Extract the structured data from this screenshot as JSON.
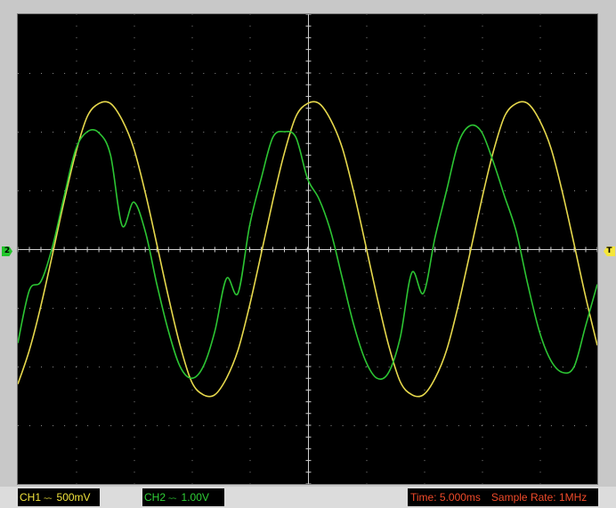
{
  "chart_data": {
    "type": "line",
    "title": "",
    "xlabel": "",
    "ylabel": "",
    "grid": true,
    "grid_divisions": {
      "x": 10,
      "y": 8
    },
    "xlim": [
      -25,
      25
    ],
    "x_unit": "ms",
    "series": [
      {
        "name": "CH1",
        "color": "#e6d84c",
        "ylim": [
          -2.0,
          2.0
        ],
        "y_unit": "V",
        "description": "sine wave, period ~20ms, amplitude ~1.27V, flat-topped",
        "x": [
          -25,
          -24,
          -23,
          -22,
          -21,
          -20,
          -19,
          -18,
          -17,
          -16,
          -15,
          -14,
          -13,
          -12,
          -11,
          -10,
          -9,
          -8,
          -7,
          -6,
          -5,
          -4,
          -3,
          -2,
          -1,
          0,
          1,
          2,
          3,
          4,
          5,
          6,
          7,
          8,
          9,
          10,
          11,
          12,
          13,
          14,
          15,
          16,
          17,
          18,
          19,
          20,
          21,
          22,
          23,
          24,
          25
        ],
        "values": [
          -1.15,
          -0.86,
          -0.48,
          -0.04,
          0.41,
          0.82,
          1.13,
          1.24,
          1.24,
          1.1,
          0.86,
          0.48,
          0.04,
          -0.41,
          -0.82,
          -1.13,
          -1.24,
          -1.24,
          -1.1,
          -0.86,
          -0.48,
          -0.04,
          0.41,
          0.82,
          1.13,
          1.24,
          1.24,
          1.1,
          0.86,
          0.48,
          0.04,
          -0.41,
          -0.82,
          -1.13,
          -1.24,
          -1.24,
          -1.1,
          -0.86,
          -0.48,
          -0.04,
          0.41,
          0.82,
          1.13,
          1.24,
          1.24,
          1.1,
          0.86,
          0.48,
          0.04,
          -0.41,
          -0.82
        ]
      },
      {
        "name": "CH2",
        "color": "#2cc533",
        "ylim": [
          -4.0,
          4.0
        ],
        "y_unit": "V",
        "description": "sine wave with distortion bumps, amplitude ~2V",
        "x": [
          -25,
          -24,
          -23,
          -22,
          -21,
          -20,
          -19,
          -18,
          -17,
          -16,
          -15,
          -14,
          -13,
          -12,
          -11,
          -10,
          -9,
          -8,
          -7,
          -6,
          -5,
          -4,
          -3,
          -2,
          -1,
          0,
          1,
          2,
          3,
          4,
          5,
          6,
          7,
          8,
          9,
          10,
          11,
          12,
          13,
          14,
          15,
          16,
          17,
          18,
          19,
          20,
          21,
          22,
          23,
          24,
          25
        ],
        "values": [
          -1.6,
          -0.7,
          -0.55,
          0.05,
          0.9,
          1.7,
          2.0,
          1.98,
          1.6,
          0.4,
          0.8,
          0.3,
          -0.6,
          -1.4,
          -2.0,
          -2.2,
          -2.0,
          -1.4,
          -0.5,
          -0.75,
          0.4,
          1.2,
          1.9,
          2.0,
          1.9,
          1.2,
          0.85,
          0.3,
          -0.5,
          -1.3,
          -1.9,
          -2.2,
          -2.1,
          -1.5,
          -0.4,
          -0.75,
          0.2,
          1.0,
          1.8,
          2.1,
          2.0,
          1.5,
          0.9,
          0.3,
          -0.6,
          -1.4,
          -1.9,
          -2.1,
          -2.0,
          -1.3,
          -0.6
        ]
      }
    ]
  },
  "markers": {
    "ch2_ground": "2",
    "trigger": "T"
  },
  "status": {
    "ch1_label": "CH1",
    "ch1_coupling": "~~",
    "ch1_scale": "500mV",
    "ch2_label": "CH2",
    "ch2_coupling": "~~",
    "ch2_scale": "1.00V",
    "timebase": "Time: 5.000ms",
    "sample_rate": "Sample Rate: 1MHz"
  }
}
